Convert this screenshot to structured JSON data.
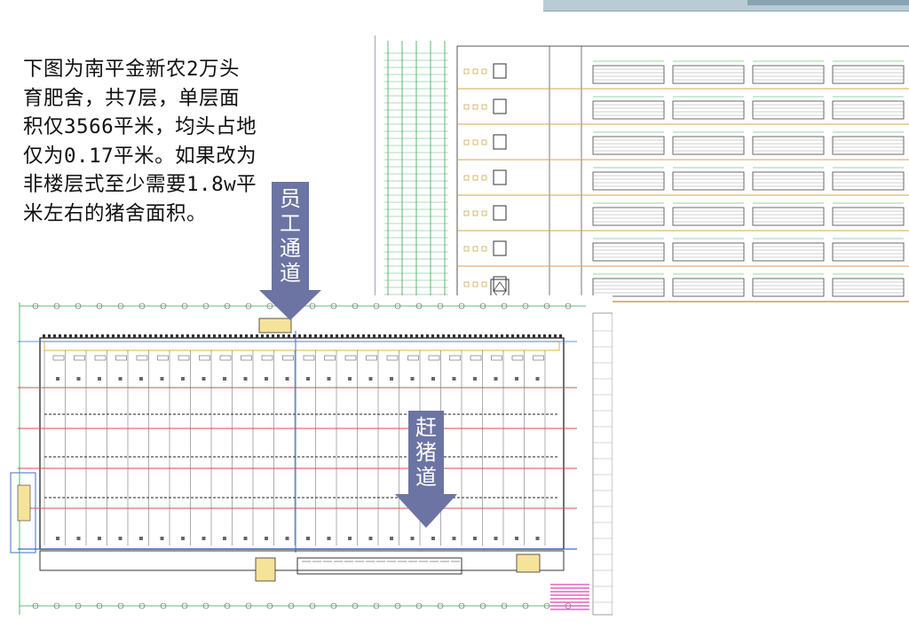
{
  "intro": {
    "lines": [
      "下图为南平金新农2万头",
      "育肥舍，共7层，单层面",
      "积仅3566平米，均头占地",
      "仅为0.17平米。如果改为",
      "非楼层式至少需要1.8w平",
      "米左右的猪舍面积。"
    ]
  },
  "callouts": {
    "staff": [
      "员",
      "工",
      "通",
      "道"
    ],
    "pig": [
      "赶",
      "猪",
      "道"
    ]
  },
  "colors": {
    "callout_fill": "#6c74a4",
    "plan_green": "#2fa84f",
    "plan_red": "#e0474c",
    "plan_blue": "#3b6fd0"
  }
}
